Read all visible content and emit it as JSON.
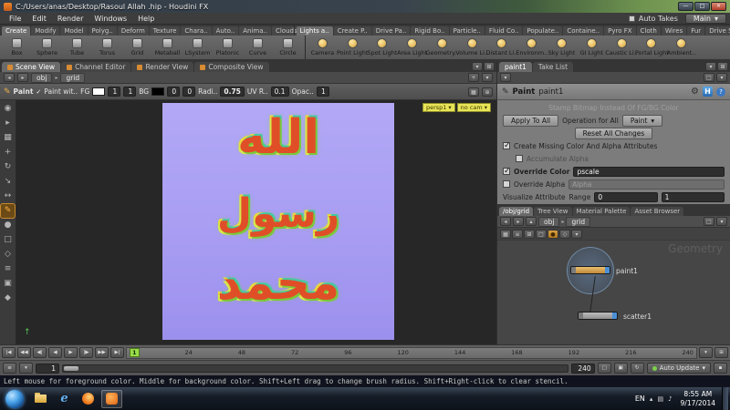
{
  "window": {
    "title": "C:/Users/anas/Desktop/Rasoul Allah .hip - Houdini FX"
  },
  "menubar": {
    "items": [
      "File",
      "Edit",
      "Render",
      "Windows",
      "Help"
    ],
    "auto_takes_label": "Auto Takes",
    "take_menu_label": "Main"
  },
  "shelf": {
    "tabs_left": [
      "Create",
      "Modify",
      "Model",
      "Polyg..",
      "Deform",
      "Texture",
      "Chara..",
      "Auto..",
      "Anima..",
      "Clouds"
    ],
    "tabs_right": [
      "Lights a..",
      "Create P..",
      "Drive Pa..",
      "Rigid Bo..",
      "Particle..",
      "Fluid Co..",
      "Populate..",
      "Containe..",
      "Pyro FX",
      "Cloth",
      "Wires",
      "Fur",
      "Drive Si.."
    ],
    "tools_left": [
      "Box",
      "Sphere",
      "Tube",
      "Torus",
      "Grid",
      "Metaball",
      "LSystem",
      "Platonic",
      "Curve",
      "Circle"
    ],
    "tools_right": [
      "Camera",
      "Point Light",
      "Spot Light",
      "Area Light",
      "Geometry..",
      "Volume Li..",
      "Distant Li..",
      "Environm..",
      "Sky Light",
      "GI Light",
      "Caustic Li..",
      "Portal Light",
      "Ambient.."
    ]
  },
  "left_pane": {
    "tabs": [
      "Scene View",
      "Channel Editor",
      "Render View",
      "Composite View"
    ],
    "path": {
      "context": "obj",
      "node": "grid"
    },
    "paint_toolbar": {
      "tool_label": "Paint",
      "mode_label": "Paint wit..",
      "fg_label": "FG",
      "fg_x": "1",
      "fg_y": "1",
      "bg_label": "BG",
      "bg_x": "0",
      "bg_y": "0",
      "radius_label": "Radi..",
      "radius_value": "0.75",
      "uv_label": "UV R..",
      "uv_value": "0.1",
      "opacity_label": "Opac..",
      "opacity_value": "1"
    },
    "viewport": {
      "camera_label": "persp1",
      "cam_menu_label": "no cam",
      "canvas_lines": [
        "الله",
        "رسول",
        "محمد"
      ]
    }
  },
  "right_pane": {
    "tabs": [
      "paint1",
      "Take List"
    ],
    "header": {
      "tool": "Paint",
      "node": "paint1"
    },
    "params": {
      "stamp_label": "Stamp Bitmap Instead Of FG/BG Color",
      "apply_all_label": "Apply To All",
      "operation_label": "Operation for All",
      "operation_value": "Paint",
      "reset_label": "Reset All Changes",
      "create_missing_label": "Create Missing Color And Alpha Attributes",
      "create_missing_checked": true,
      "accumulate_label": "Accumulate Alpha",
      "accumulate_checked": false,
      "override_color_label": "Override Color",
      "override_color_value": "pscale",
      "override_color_checked": true,
      "override_alpha_label": "Override Alpha",
      "override_alpha_value": "Alpha",
      "override_alpha_checked": false,
      "visualize_label": "Visualize Attribute",
      "range_label": "Range",
      "range_min": "0",
      "range_max": "1"
    },
    "network": {
      "tabs": [
        "/obj/grid",
        "Tree View",
        "Material Palette",
        "Asset Browser"
      ],
      "path": {
        "context": "obj",
        "node": "grid"
      },
      "watermark": "Geometry",
      "nodes": [
        {
          "name": "paint1",
          "selected": true
        },
        {
          "name": "scatter1",
          "selected": false
        }
      ]
    }
  },
  "timeline": {
    "frames": [
      "1",
      "24",
      "48",
      "72",
      "96",
      "120",
      "144",
      "168",
      "192",
      "216",
      "240"
    ],
    "range_start": "1",
    "range_end": "240",
    "auto_update_label": "Auto Update"
  },
  "statusbar": {
    "message": "Left mouse for foreground color. Middle for background color. Shift+Left drag to change brush radius. Shift+Right-click to clear stencil."
  },
  "taskbar": {
    "language": "EN",
    "time": "8:55 AM",
    "date": "9/17/2014"
  },
  "colors": {
    "accent_orange": "#d67e3c",
    "canvas_purple": "#a89df2",
    "paint_stroke": "#e04e28",
    "paint_fringe": "#7cc83c",
    "selection_blue": "#5c86b8",
    "playhead_green": "#9adb4a"
  }
}
